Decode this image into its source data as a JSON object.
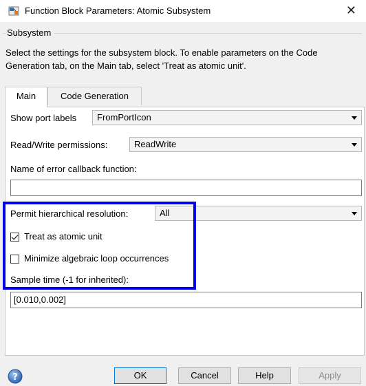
{
  "window": {
    "title": "Function Block Parameters: Atomic Subsystem",
    "close_glyph": "✕"
  },
  "group": {
    "label": "Subsystem",
    "description": "Select the settings for the subsystem block. To enable parameters on the Code Generation tab, on the Main tab, select 'Treat as atomic unit'."
  },
  "tabs": [
    {
      "label": "Main",
      "active": true
    },
    {
      "label": "Code Generation",
      "active": false
    }
  ],
  "fields": {
    "show_port_labels": {
      "label": "Show port labels",
      "value": "FromPortIcon"
    },
    "rw_permissions": {
      "label": "Read/Write permissions:",
      "value": "ReadWrite"
    },
    "error_callback": {
      "label": "Name of error callback function:",
      "value": ""
    },
    "hierarchical_resolution": {
      "label": "Permit hierarchical resolution:",
      "value": "All"
    },
    "treat_atomic": {
      "label": "Treat as atomic unit",
      "checked": true
    },
    "minimize_loops": {
      "label": "Minimize algebraic loop occurrences",
      "checked": false
    },
    "sample_time": {
      "label": "Sample time (-1 for inherited):",
      "value": "[0.010,0.002]"
    }
  },
  "buttons": {
    "ok": "OK",
    "cancel": "Cancel",
    "help": "Help",
    "apply": "Apply"
  },
  "colors": {
    "highlight": "#0000e6",
    "default_button_border": "#0078d7"
  }
}
